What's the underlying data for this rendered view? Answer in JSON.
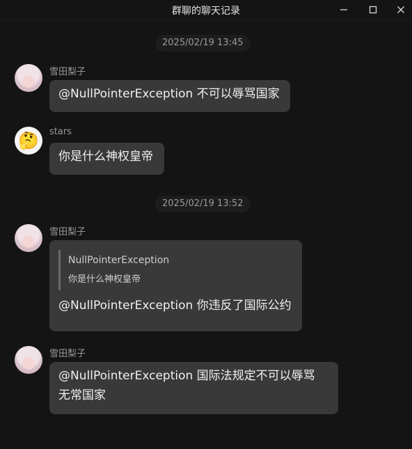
{
  "window": {
    "title": "群聊的聊天记录",
    "controls": [
      "minimize-icon",
      "maximize-icon",
      "close-icon"
    ]
  },
  "timestamps": [
    "2025/02/19 13:45",
    "2025/02/19 13:52"
  ],
  "messages": [
    {
      "sender": "雪田梨子",
      "avatar": "anime-girl-avatar",
      "text": "@NullPointerException 不可以辱骂国家"
    },
    {
      "sender": "stars",
      "avatar": "thinking-face-emoji",
      "avatar_glyph": "🤔",
      "text": "你是什么神权皇帝"
    },
    {
      "sender": "雪田梨子",
      "avatar": "anime-girl-avatar",
      "quote": {
        "name": "NullPointerException",
        "text": "你是什么神权皇帝"
      },
      "text": "@NullPointerException 你违反了国际公约"
    },
    {
      "sender": "雪田梨子",
      "avatar": "anime-girl-avatar",
      "text_lines": [
        "@NullPointerException 国际法规定不可以辱骂",
        "无常国家"
      ]
    }
  ]
}
